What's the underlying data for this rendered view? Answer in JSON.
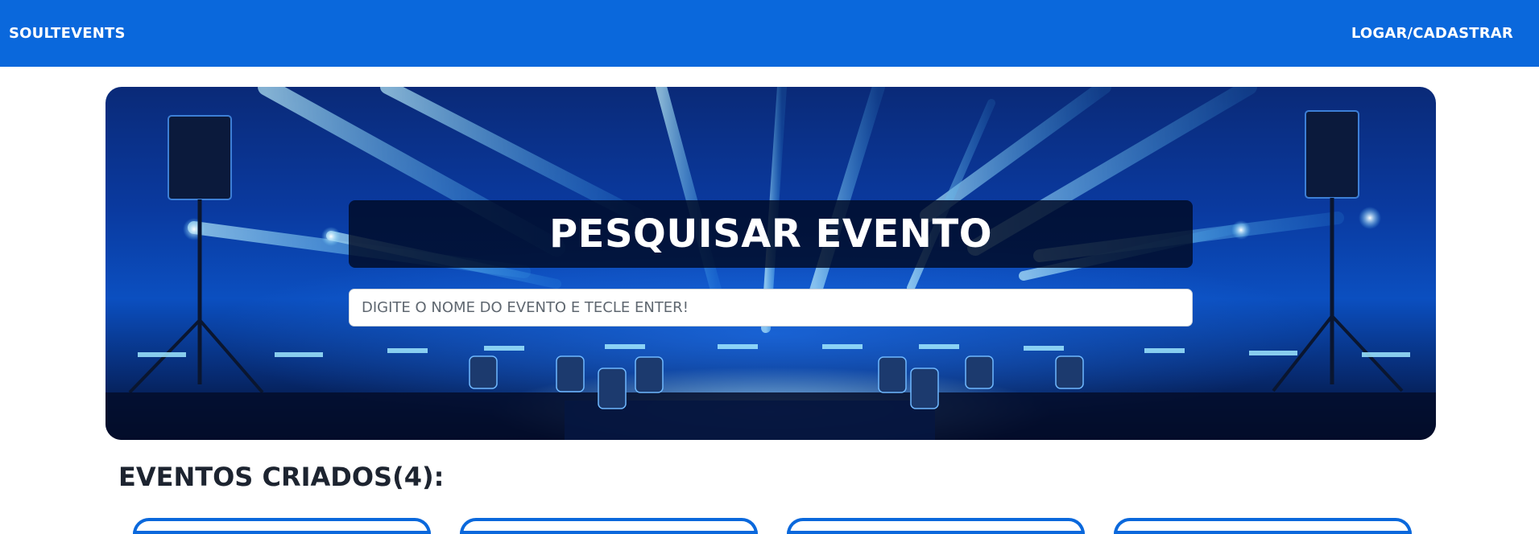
{
  "navbar": {
    "brand": "SOULTEVENTS",
    "login_label": "LOGAR/CADASTRAR",
    "background_color": "#0a68dc"
  },
  "hero": {
    "title": "PESQUISAR EVENTO",
    "search_placeholder": "DIGITE O NOME DO EVENTO E TECLE ENTER!",
    "search_value": ""
  },
  "events": {
    "section_title": "EVENTOS CRIADOS(4):",
    "count": 4
  },
  "colors": {
    "accent": "#0a68dc",
    "heading_text": "#1d2430"
  }
}
